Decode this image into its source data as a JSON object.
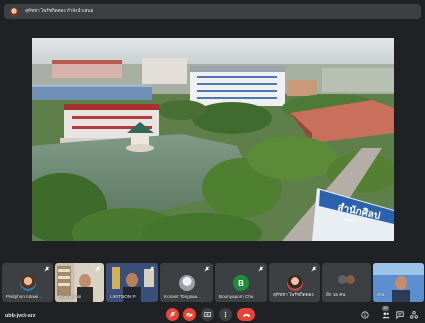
{
  "presenter": {
    "name": "สุทัชชา ไพรัชกิตตอง กำลังนำเสนอ"
  },
  "main_video": {
    "sign_text": "สำนักศิลป",
    "sign_subtext": "SILAPA"
  },
  "participants": [
    {
      "name": "Pisitphon Intawi...",
      "muted": true
    },
    {
      "name": "Poun Pinoi",
      "muted": true
    },
    {
      "name": "LIKITNON P.",
      "muted": true
    },
    {
      "name": "Koranit Tongsaa...",
      "muted": true
    },
    {
      "name": "Boonyaporn Chu",
      "initial": "B",
      "muted": true
    },
    {
      "name": "สุทัชชา ไพรัชกิตตอง",
      "muted": true
    },
    {
      "name": "อีก 15 คน"
    },
    {
      "name": "คุณ"
    }
  ],
  "toolbar": {
    "meeting_code": "ubb-jvct-srz",
    "participants_count": "20"
  },
  "colors": {
    "background": "#202124",
    "tile": "#3c4043",
    "danger": "#ea4335"
  },
  "icons": {
    "mic": "mic-off-icon",
    "camera": "camera-off-icon",
    "present": "present-screen-icon",
    "more": "more-vert-icon",
    "end": "end-call-icon",
    "info": "info-icon",
    "people": "people-icon",
    "chat": "chat-icon",
    "activities": "activities-icon"
  }
}
